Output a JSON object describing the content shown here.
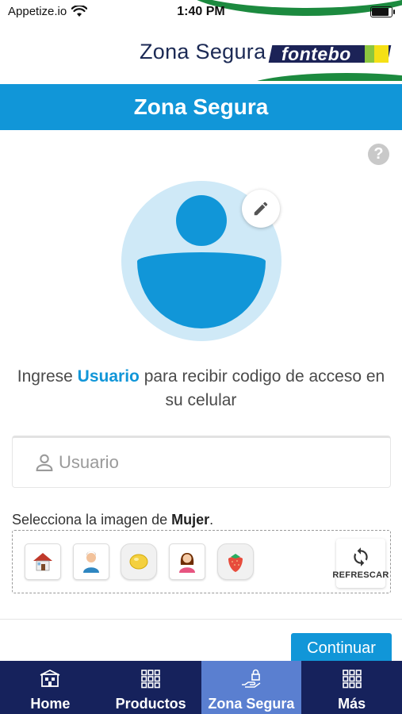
{
  "status_bar": {
    "carrier": "Appetize.io",
    "time": "1:40 PM",
    "battery_level": 0.9
  },
  "brand": {
    "title": "Zona Segura",
    "logo_text": "fontebo"
  },
  "header": {
    "title": "Zona Segura"
  },
  "help": {
    "label": "?"
  },
  "instruction": {
    "prefix": "Ingrese ",
    "highlight": "Usuario",
    "suffix": " para recibir codigo de acceso en su celular"
  },
  "username_field": {
    "placeholder": "Usuario",
    "value": ""
  },
  "image_selection": {
    "prefix": "Selecciona la imagen de ",
    "target": "Mujer",
    "suffix": ".",
    "options": [
      "house-icon",
      "man-icon",
      "lemon-icon",
      "woman-icon",
      "strawberry-icon"
    ],
    "refresh_label": "REFRESCAR"
  },
  "continue_label": "Continuar",
  "bottom_nav": {
    "items": [
      {
        "label": "Home",
        "icon": "home-icon",
        "active": false
      },
      {
        "label": "Productos",
        "icon": "grid-icon",
        "active": false
      },
      {
        "label": "Zona Segura",
        "icon": "secure-hand-icon",
        "active": true
      },
      {
        "label": "Más",
        "icon": "grid-icon",
        "active": false
      }
    ]
  },
  "colors": {
    "primary": "#1196d8",
    "nav_bg": "#16225c",
    "nav_active": "#5a7fd0",
    "brand_green": "#1c8a3f"
  }
}
